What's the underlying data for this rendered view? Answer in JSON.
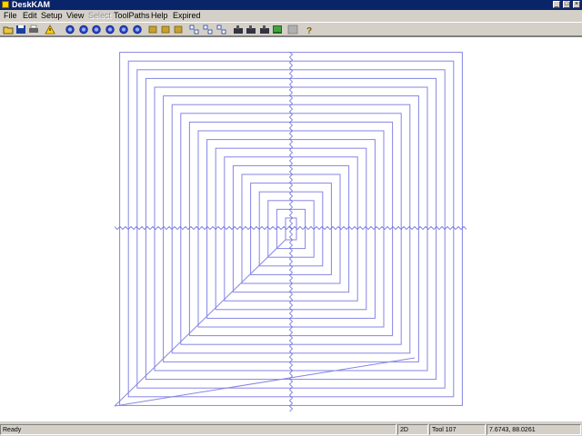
{
  "title": "DeskKAM",
  "menu": [
    {
      "label": "File",
      "enabled": true
    },
    {
      "label": "Edit",
      "enabled": true
    },
    {
      "label": "Setup",
      "enabled": true
    },
    {
      "label": "View",
      "enabled": true
    },
    {
      "label": "Select",
      "enabled": false
    },
    {
      "label": "ToolPaths",
      "enabled": true
    },
    {
      "label": "Help",
      "enabled": true
    },
    {
      "label": "Expired",
      "enabled": true
    }
  ],
  "toolbar": [
    "open-icon",
    "save-icon",
    "print-icon",
    "warning-icon",
    "zoom-in-icon",
    "zoom-out-icon",
    "zoom-window-icon",
    "zoom-all-icon",
    "zoom-previous-icon",
    "zoom-extents-icon",
    "layers-icon",
    "settings-icon",
    "tool-icon",
    "select-nodes-icon",
    "group-icon",
    "ungroup-icon",
    "machine-icon",
    "machine-run-icon",
    "drill-icon",
    "toolpath-icon",
    "grid-icon",
    "help-icon"
  ],
  "status": {
    "message": "Ready",
    "mode": "2D",
    "tool": "Tool 107",
    "coords": "7.6743, 88.0261"
  },
  "colors": {
    "titlebar": "#0a246a",
    "toolpath": "#8585e6",
    "axis": "#6d6dd8"
  }
}
